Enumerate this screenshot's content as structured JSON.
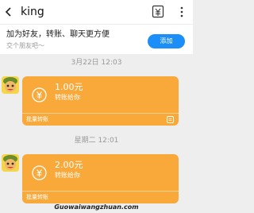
{
  "header": {
    "title": "king",
    "back_icon": "chevron-left-icon",
    "transfer_icon": "yuan-transfer-icon",
    "more_icon": "more-vertical-icon"
  },
  "banner": {
    "title": "加为好友，转账、聊天更方便",
    "subtitle": "交个朋友吧～",
    "add_label": "添加",
    "accent": "#1b8ef7"
  },
  "messages": [
    {
      "timestamp": "3月22日 12:03",
      "amount": "1.00元",
      "description": "转账给你",
      "footer": "批量转账"
    },
    {
      "timestamp": "星期二 12:01",
      "amount": "2.00元",
      "description": "转账给你",
      "footer": "批量转账"
    }
  ],
  "colors": {
    "card": "#f8a93a",
    "background": "#eeeeee"
  },
  "watermark": "Guowaiwangzhuan.com"
}
